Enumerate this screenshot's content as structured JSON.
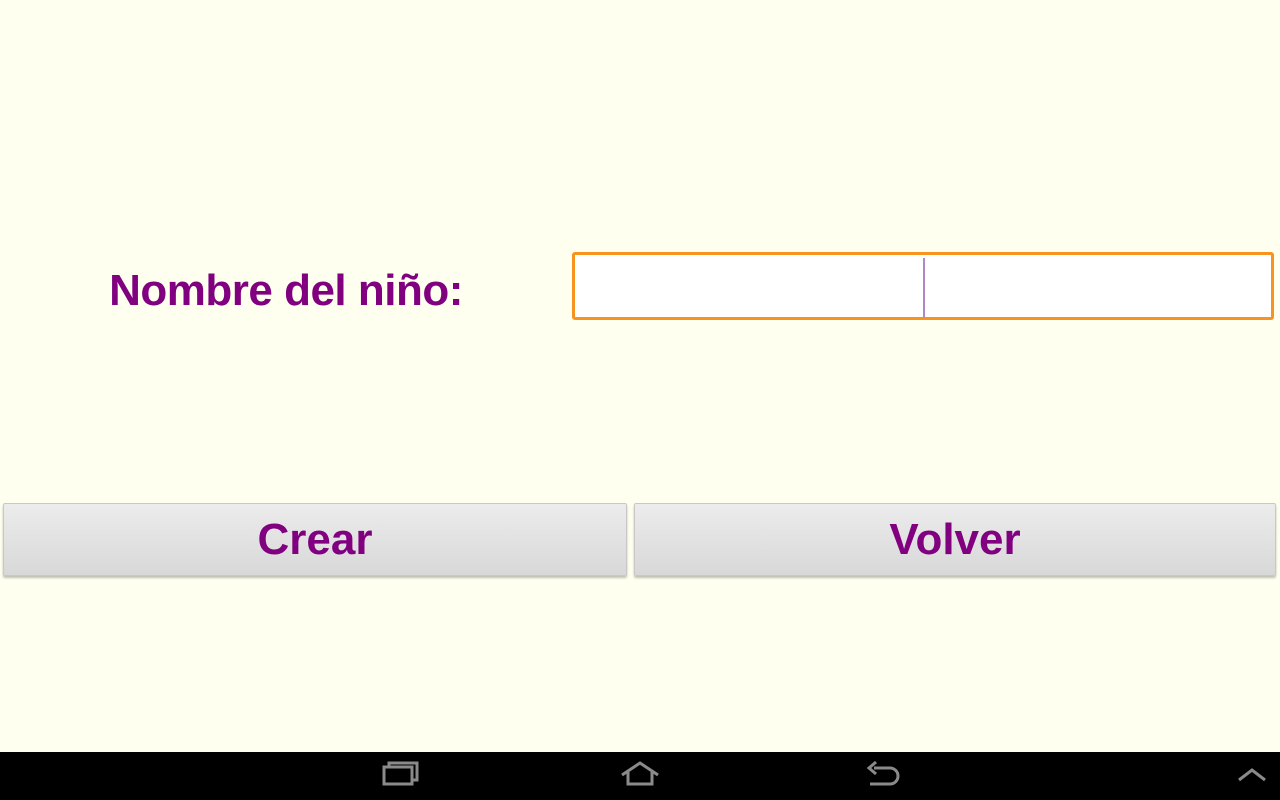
{
  "form": {
    "name_label": "Nombre del niño:",
    "name_value": "",
    "name_placeholder": ""
  },
  "buttons": {
    "create_label": "Crear",
    "back_label": "Volver"
  },
  "navbar": {
    "icons": [
      "recent-apps-icon",
      "home-icon",
      "back-icon",
      "chevron-up-icon"
    ]
  },
  "colors": {
    "background": "#fffff0",
    "text_accent": "#800080",
    "input_focus_border": "#f7931e",
    "button_fill": "#e0e0e0",
    "navbar": "#000000"
  }
}
